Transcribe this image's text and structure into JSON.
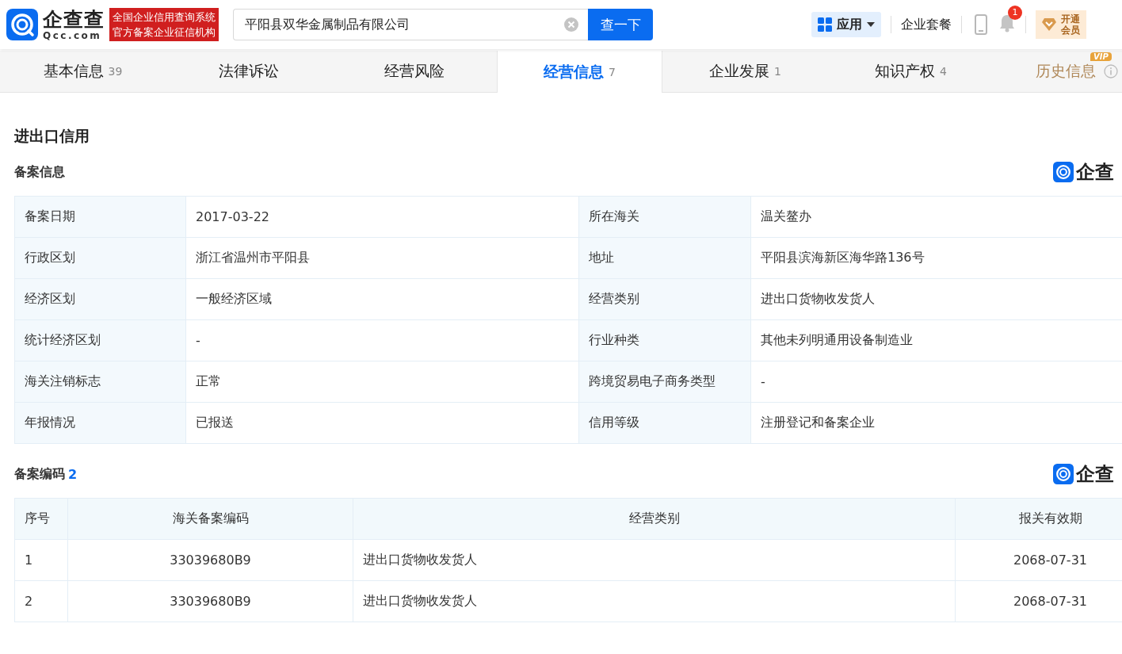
{
  "header": {
    "logo": {
      "name": "企查查",
      "domain": "Qcc.com"
    },
    "slogan": [
      "全国企业信用查询系统",
      "官方备案企业征信机构"
    ],
    "search": {
      "value": "平阳县双华金属制品有限公司"
    },
    "search_button": "查一下",
    "apps": "应用",
    "package": "企业套餐",
    "notifications": {
      "badge": "1"
    },
    "vip": [
      "开通",
      "会员"
    ]
  },
  "tabs": [
    {
      "label": "基本信息",
      "count": "39",
      "selected": false
    },
    {
      "label": "法律诉讼",
      "selected": false
    },
    {
      "label": "经营风险",
      "selected": false
    },
    {
      "label": "经营信息",
      "count": "7",
      "selected": true
    },
    {
      "label": "企业发展",
      "count": "1",
      "selected": false
    },
    {
      "label": "知识产权",
      "count": "4",
      "selected": false
    },
    {
      "label": "历史信息",
      "badge": "VIP",
      "selected": false
    }
  ],
  "section_title": "进出口信用",
  "filing": {
    "title": "备案信息",
    "brand": "企查",
    "rows": [
      {
        "label_1": "备案日期",
        "value_1": "2017-03-22",
        "label_2": "所在海关",
        "value_2": "温关鳌办"
      },
      {
        "label_1": "行政区划",
        "value_1": "浙江省温州市平阳县",
        "label_2": "地址",
        "value_2": "平阳县滨海新区海华路136号"
      },
      {
        "label_1": "经济区划",
        "value_1": "一般经济区域",
        "label_2": "经营类别",
        "value_2": "进出口货物收发货人"
      },
      {
        "label_1": "统计经济区划",
        "value_1": "-",
        "label_2": "行业种类",
        "value_2": "其他未列明通用设备制造业"
      },
      {
        "label_1": "海关注销标志",
        "value_1": "正常",
        "label_2": "跨境贸易电子商务类型",
        "value_2": "-"
      },
      {
        "label_1": "年报情况",
        "value_1": "已报送",
        "label_2": "信用等级",
        "value_2": "注册登记和备案企业"
      }
    ]
  },
  "codes": {
    "title": "备案编码",
    "count": "2",
    "brand": "企查",
    "columns": [
      "序号",
      "海关备案编码",
      "经营类别",
      "报关有效期"
    ],
    "rows": [
      [
        "1",
        "33039680B9",
        "进出口货物收发货人",
        "2068-07-31"
      ],
      [
        "2",
        "33039680B9",
        "进出口货物收发货人",
        "2068-07-31"
      ]
    ]
  }
}
